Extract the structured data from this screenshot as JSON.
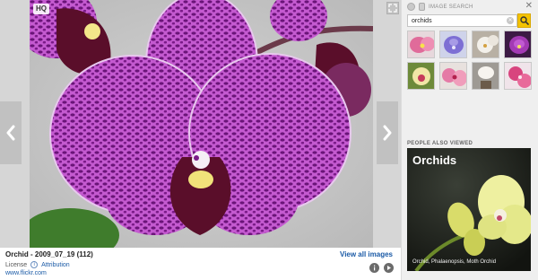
{
  "viewer": {
    "hq_badge": "HQ",
    "prev_icon": "chevron-left-icon",
    "next_icon": "chevron-right-icon",
    "expand_icon": "expand-icon",
    "colors": {
      "background": "#d6d6d6",
      "petal": "#b040c0",
      "petal_spots": "#5e0e6e",
      "nav_button": "#c0c0c0"
    }
  },
  "caption": {
    "title": "Orchid - 2009_07_19 (112)",
    "view_all": "View all images",
    "license_label": "License",
    "attribution_label": "Attribution",
    "source": "www.flickr.com",
    "info_icon": "info-icon",
    "play_icon": "play-icon"
  },
  "panel": {
    "header_label": "IMAGE SEARCH",
    "close_icon": "close-icon",
    "search": {
      "value": "orchids",
      "clear_icon": "clear-icon",
      "button_icon": "search-icon",
      "button_color": "#f4c300"
    },
    "thumbnails": [
      {
        "name": "thumb-pink-orchid"
      },
      {
        "name": "thumb-blue-orchid"
      },
      {
        "name": "thumb-white-orchid"
      },
      {
        "name": "thumb-purple-orchid"
      },
      {
        "name": "thumb-yellow-orchid"
      },
      {
        "name": "thumb-pink-spotted-orchid"
      },
      {
        "name": "thumb-white-pot-orchid"
      },
      {
        "name": "thumb-magenta-orchid"
      }
    ],
    "people_also_viewed": {
      "label": "PEOPLE ALSO VIEWED",
      "title": "Orchids",
      "caption": "Orchid, Phalaenopsis, Moth Orchid"
    }
  }
}
